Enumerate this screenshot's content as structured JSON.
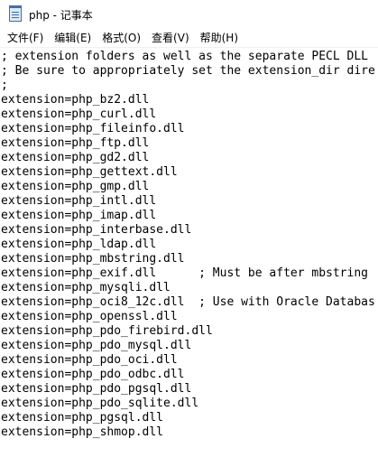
{
  "window": {
    "title": "php - 记事本"
  },
  "menu": [
    {
      "label": "文件(F)"
    },
    {
      "label": "编辑(E)"
    },
    {
      "label": "格式(O)"
    },
    {
      "label": "查看(V)"
    },
    {
      "label": "帮助(H)"
    }
  ],
  "editor": {
    "lines": [
      "; extension folders as well as the separate PECL DLL",
      "; Be sure to appropriately set the extension_dir dire",
      ";",
      "extension=php_bz2.dll",
      "extension=php_curl.dll",
      "extension=php_fileinfo.dll",
      "extension=php_ftp.dll",
      "extension=php_gd2.dll",
      "extension=php_gettext.dll",
      "extension=php_gmp.dll",
      "extension=php_intl.dll",
      "extension=php_imap.dll",
      "extension=php_interbase.dll",
      "extension=php_ldap.dll",
      "extension=php_mbstring.dll",
      "extension=php_exif.dll      ; Must be after mbstring",
      "extension=php_mysqli.dll",
      "extension=php_oci8_12c.dll  ; Use with Oracle Databas",
      "extension=php_openssl.dll",
      "extension=php_pdo_firebird.dll",
      "extension=php_pdo_mysql.dll",
      "extension=php_pdo_oci.dll",
      "extension=php_pdo_odbc.dll",
      "extension=php_pdo_pgsql.dll",
      "extension=php_pdo_sqlite.dll",
      "extension=php_pgsql.dll",
      "extension=php_shmop.dll"
    ]
  }
}
